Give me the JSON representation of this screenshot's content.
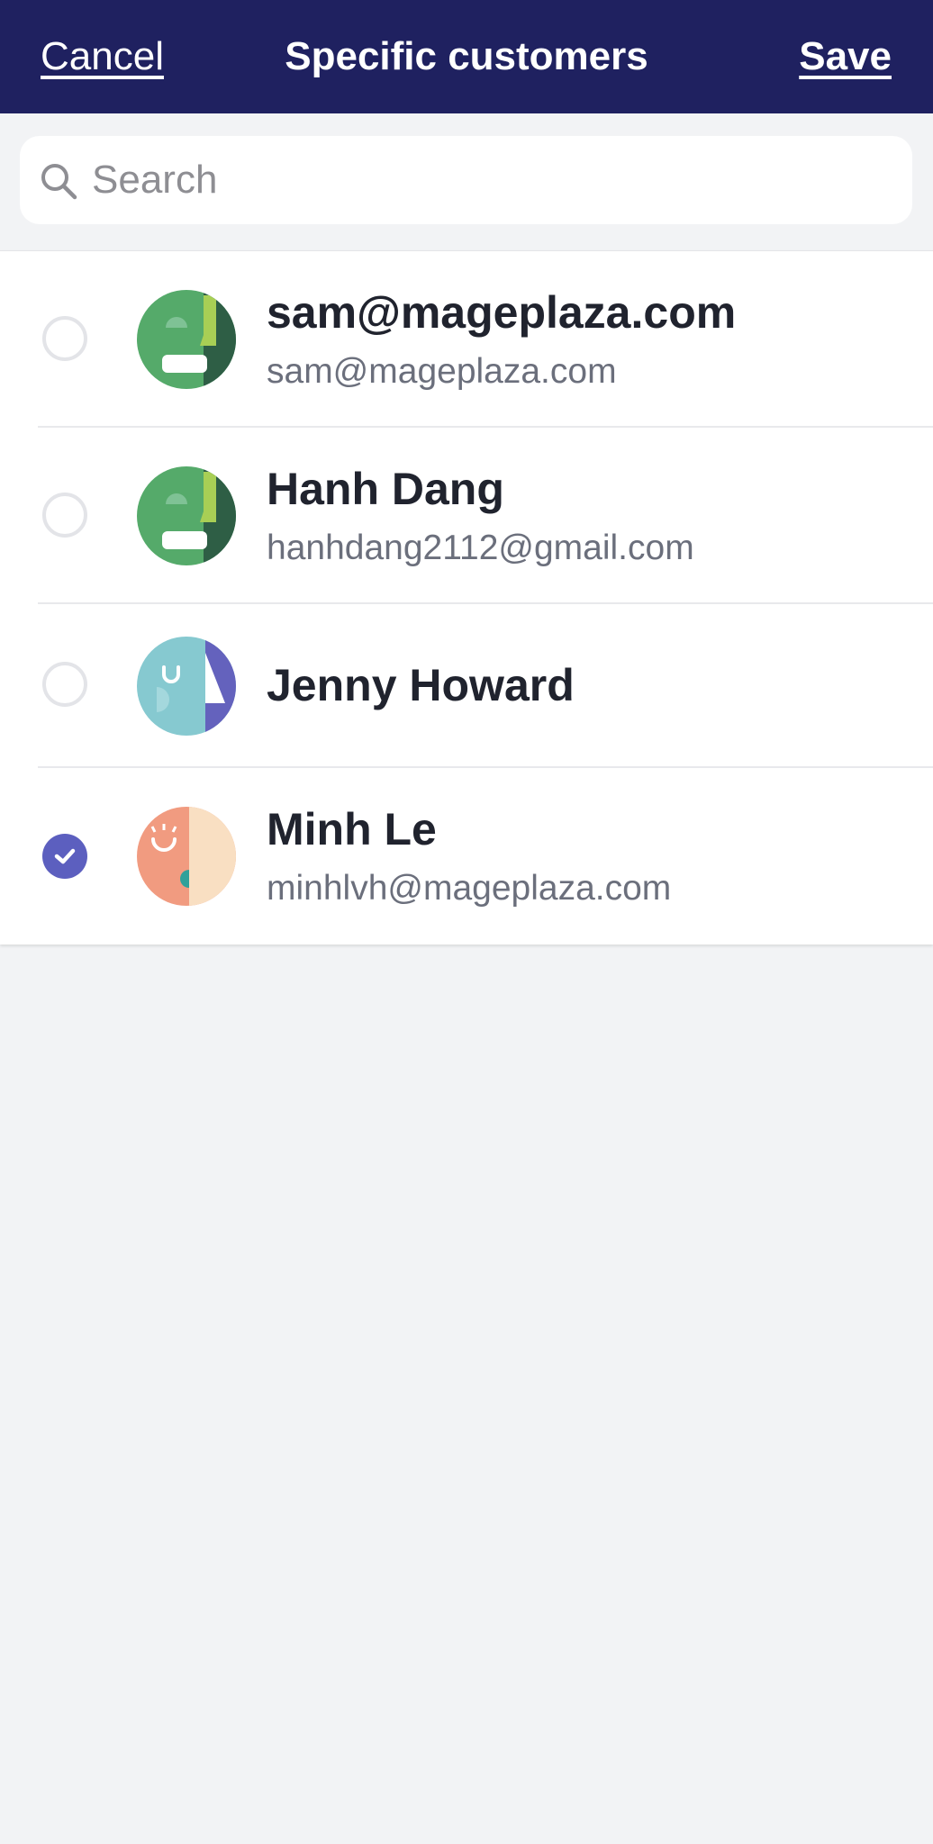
{
  "header": {
    "title": "Specific customers",
    "cancel_label": "Cancel",
    "save_label": "Save"
  },
  "search": {
    "placeholder": "Search",
    "value": ""
  },
  "customers": [
    {
      "name": "sam@mageplaza.com",
      "email": "sam@mageplaza.com",
      "selected": false,
      "avatar": "green-face-avatar"
    },
    {
      "name": "Hanh Dang",
      "email": "hanhdang2112@gmail.com",
      "selected": false,
      "avatar": "green-face-avatar"
    },
    {
      "name": "Jenny Howard",
      "email": "",
      "selected": false,
      "avatar": "teal-face-avatar"
    },
    {
      "name": "Minh Le",
      "email": "minhlvh@mageplaza.com",
      "selected": true,
      "avatar": "peach-face-avatar"
    }
  ],
  "colors": {
    "header_bg": "#1f2160",
    "accent": "#5c5fbf",
    "page_bg": "#f2f3f5"
  }
}
